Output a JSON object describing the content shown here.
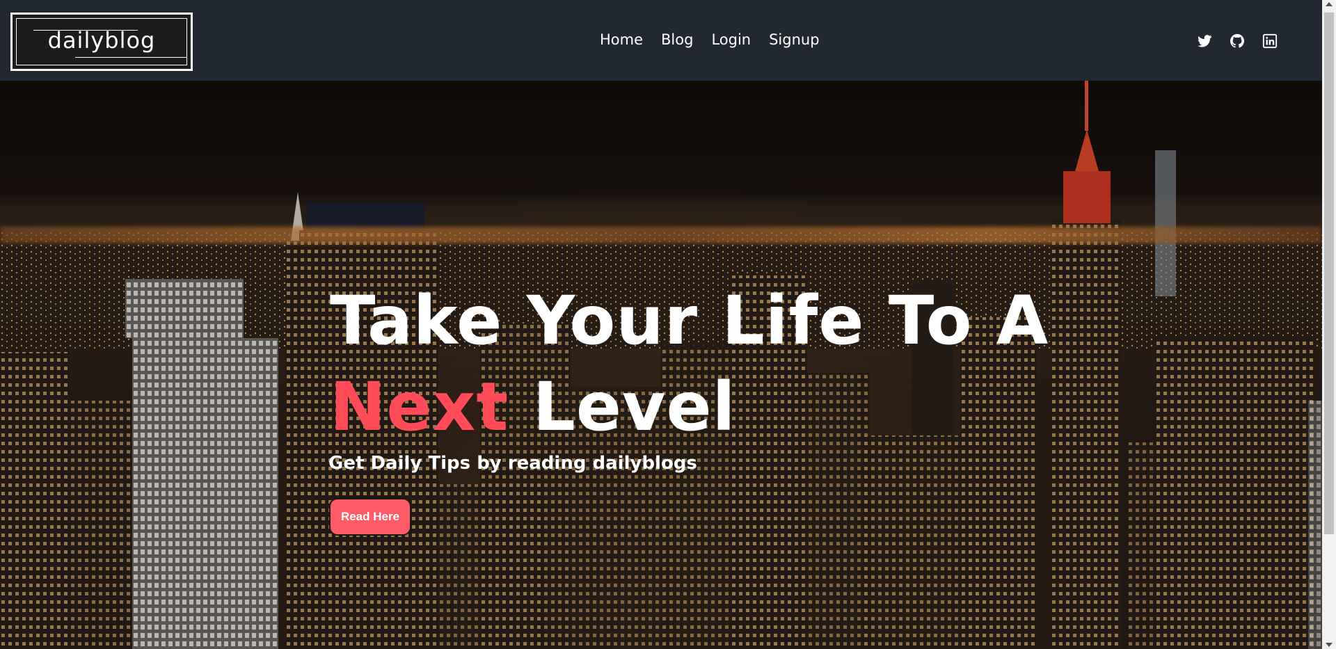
{
  "brand": {
    "name": "dailyblog"
  },
  "nav": {
    "links": [
      {
        "label": "Home"
      },
      {
        "label": "Blog"
      },
      {
        "label": "Login"
      },
      {
        "label": "Signup"
      }
    ]
  },
  "social": {
    "icons": [
      "twitter-icon",
      "github-icon",
      "linkedin-icon"
    ]
  },
  "hero": {
    "title_line1": "Take Your Life To A",
    "title_accent": "Next",
    "title_rest": "Level",
    "subtitle": "Get Daily Tips by reading dailyblogs",
    "button_label": "Read Here"
  },
  "colors": {
    "navbar_bg": "#222831",
    "accent": "#ff4c58",
    "button_bg": "#ff5b69",
    "text": "#ffffff"
  }
}
